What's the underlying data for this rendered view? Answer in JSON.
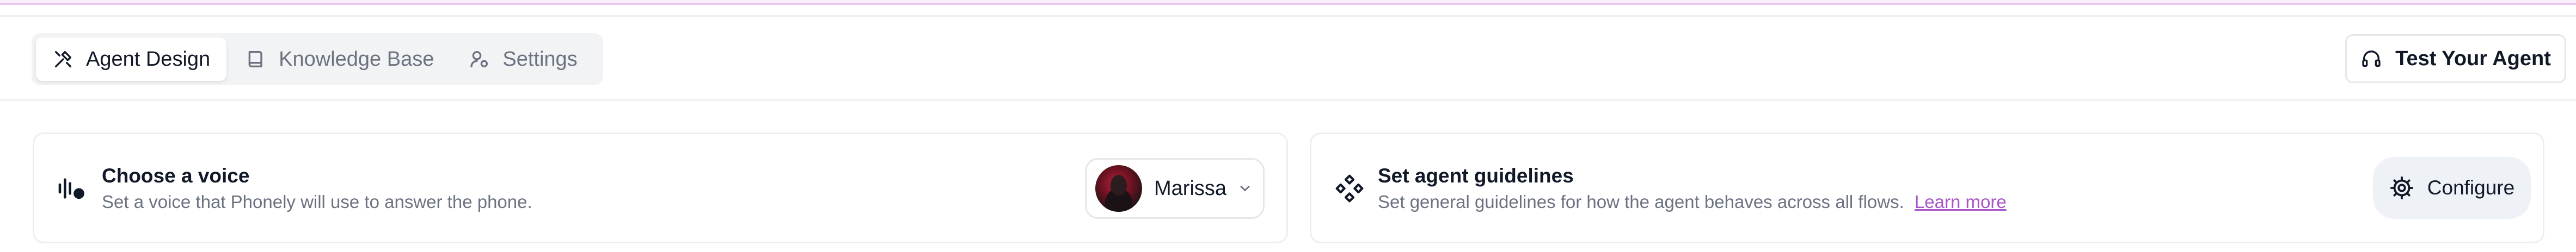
{
  "tabs": [
    {
      "label": "Agent Design",
      "icon": "agent-design-icon",
      "active": true
    },
    {
      "label": "Knowledge Base",
      "icon": "book-icon",
      "active": false
    },
    {
      "label": "Settings",
      "icon": "user-settings-icon",
      "active": false
    }
  ],
  "header": {
    "test_button_label": "Test Your Agent",
    "test_button_icon": "headset-icon"
  },
  "voice_card": {
    "icon": "voice-waveform-icon",
    "title": "Choose a voice",
    "description": "Set a voice that Phonely will use to answer the phone.",
    "selected_voice": "Marissa",
    "dropdown_icon": "chevron-down-icon"
  },
  "guidelines_card": {
    "icon": "diamond-cluster-icon",
    "title": "Set agent guidelines",
    "description": "Set general guidelines for how the agent behaves across all flows.",
    "link_text": "Learn more",
    "button_label": "Configure",
    "button_icon": "gear-icon"
  },
  "colors": {
    "accent_link": "#a855c7",
    "top_accent": "#ebc7f0",
    "muted_text": "#6b7280",
    "primary_text": "#111827"
  }
}
